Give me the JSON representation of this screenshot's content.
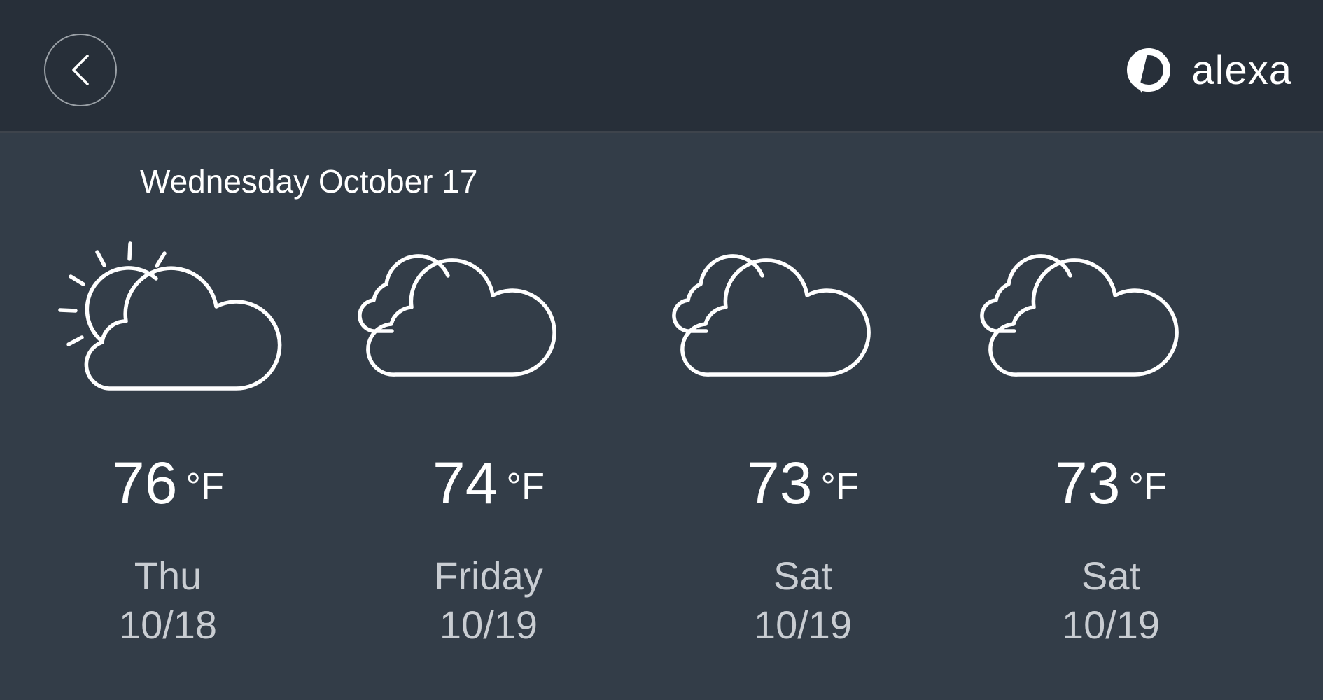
{
  "header": {
    "back_icon": "chevron-left-icon",
    "brand_icon": "alexa-ring-icon",
    "brand_name": "alexa"
  },
  "date_title": "Wednesday October 17",
  "forecast": [
    {
      "icon": "partly-sunny-icon",
      "temp": "76",
      "unit": "°F",
      "day": "Thu",
      "date": "10/18"
    },
    {
      "icon": "cloudy-icon",
      "temp": "74",
      "unit": "°F",
      "day": "Friday",
      "date": "10/19"
    },
    {
      "icon": "cloudy-icon",
      "temp": "73",
      "unit": "°F",
      "day": "Sat",
      "date": "10/19"
    },
    {
      "icon": "cloudy-icon",
      "temp": "73",
      "unit": "°F",
      "day": "Sat",
      "date": "10/19"
    }
  ],
  "colors": {
    "header_bg": "#272f39",
    "body_bg": "#333d48",
    "text": "#ffffff",
    "muted_text": "#c9cdd2"
  }
}
